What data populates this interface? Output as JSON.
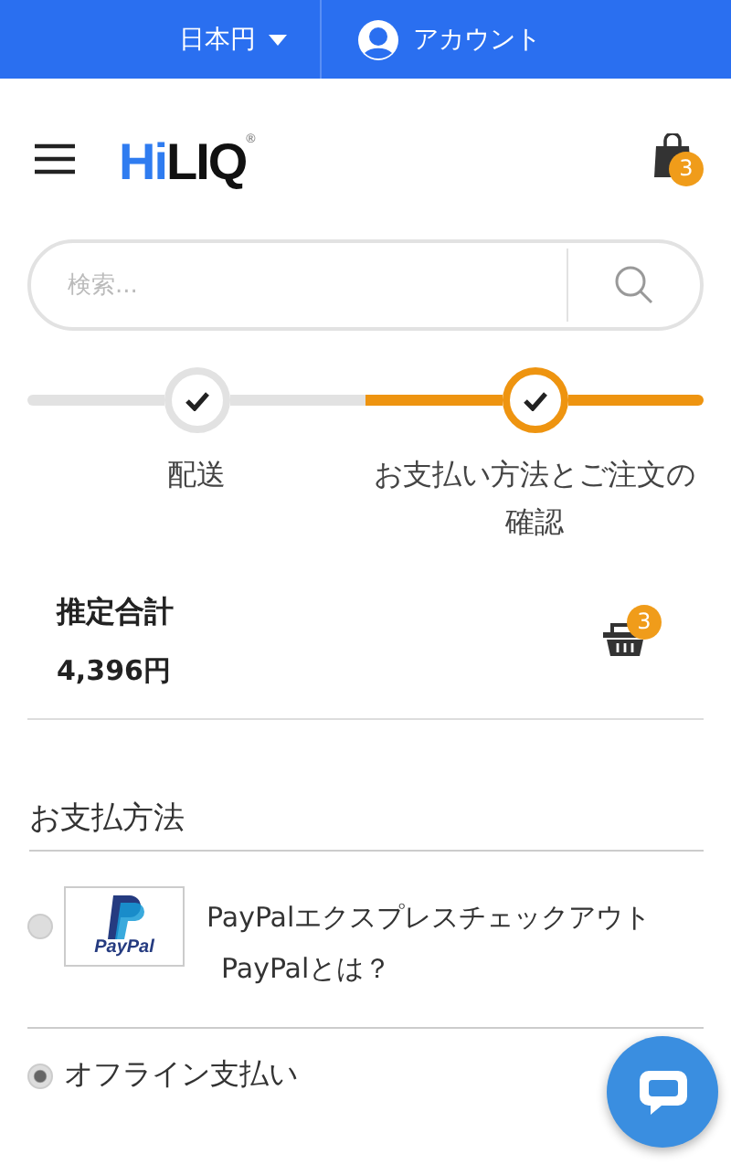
{
  "top_bar": {
    "currency": "日本円",
    "account": "アカウント"
  },
  "header": {
    "logo": {
      "accent": "Hi",
      "rest": "LIQ",
      "mark": "®"
    },
    "cart_count": "3"
  },
  "search": {
    "placeholder": "検索..."
  },
  "steps": [
    {
      "label": "配送",
      "completed": true,
      "selected": false
    },
    {
      "label": "お支払い方法とご注文の確認",
      "completed": true,
      "selected": true
    }
  ],
  "summary": {
    "title": "推定合計",
    "total": "4,396円",
    "item_count": "3"
  },
  "payment": {
    "heading": "お支払方法",
    "methods": [
      {
        "kind": "paypal",
        "logo_text": "PayPal",
        "label": "PayPalエクスプレスチェックアウト",
        "link": "PayPalとは？",
        "selected": false
      },
      {
        "kind": "plain",
        "label": "オフライン支払い",
        "selected": true
      }
    ]
  }
}
